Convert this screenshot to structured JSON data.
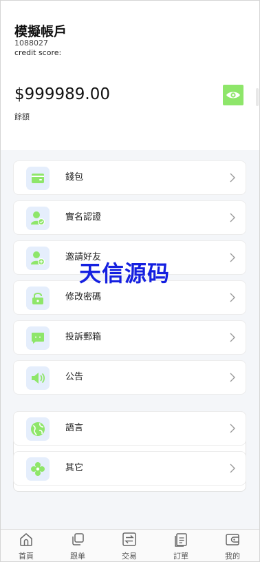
{
  "account": {
    "name": "模擬帳戶",
    "id": "1088027",
    "credit_score_label": "credit score:",
    "balance": "$999989.00",
    "balance_label": "餘額"
  },
  "menu": {
    "group1": [
      {
        "label": "錢包",
        "icon": "wallet-icon"
      },
      {
        "label": "實名認證",
        "icon": "user-verify-icon"
      },
      {
        "label": "邀請好友",
        "icon": "user-add-icon"
      },
      {
        "label": "修改密碼",
        "icon": "lock-icon"
      },
      {
        "label": "投訴郵箱",
        "icon": "message-icon"
      },
      {
        "label": "公告",
        "icon": "speaker-icon"
      }
    ],
    "group2": [
      {
        "label": "語言",
        "icon": "globe-icon"
      },
      {
        "label": "其它",
        "icon": "flower-icon"
      }
    ]
  },
  "watermark": "天信源码",
  "nav": [
    {
      "label": "首頁",
      "icon": "home-icon"
    },
    {
      "label": "跟单",
      "icon": "copy-icon"
    },
    {
      "label": "交易",
      "icon": "exchange-icon"
    },
    {
      "label": "訂單",
      "icon": "orders-icon"
    },
    {
      "label": "我的",
      "icon": "wallet-profile-icon"
    }
  ],
  "colors": {
    "accent_green": "#8ee66a",
    "icon_bg": "#e5eefc",
    "watermark": "#1520e0"
  }
}
